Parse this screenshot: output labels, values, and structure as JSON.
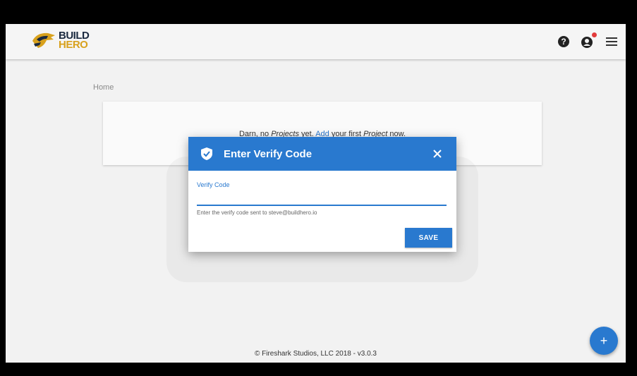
{
  "brand": {
    "line1": "BUILD",
    "line2": "HERO",
    "colors": {
      "navy": "#1b2a40",
      "gold": "#d8a11d"
    }
  },
  "header": {
    "icons": [
      "help-icon",
      "account-alert-icon",
      "menu-icon"
    ],
    "help_glyph": "?"
  },
  "breadcrumb": {
    "label": "Home"
  },
  "empty_state": {
    "text_before": "Darn, no ",
    "em1": "Projects",
    "text_mid": " yet. ",
    "link": "Add",
    "text_mid2": " your first ",
    "em2": "Project",
    "text_after": " now."
  },
  "dialog": {
    "title": "Enter Verify Code",
    "icon": "shield-check-icon",
    "close_glyph": "✕",
    "field": {
      "label": "Verify Code",
      "value": "",
      "helper": "Enter the verify code sent to steve@buildhero.io"
    },
    "save_label": "SAVE"
  },
  "fab": {
    "glyph": "+"
  },
  "footer": {
    "text": "© Fireshark Studios, LLC 2018 - v3.0.3"
  },
  "colors": {
    "primary": "#2979cf",
    "alert": "#e23b3b",
    "background": "#f2f2f2"
  }
}
